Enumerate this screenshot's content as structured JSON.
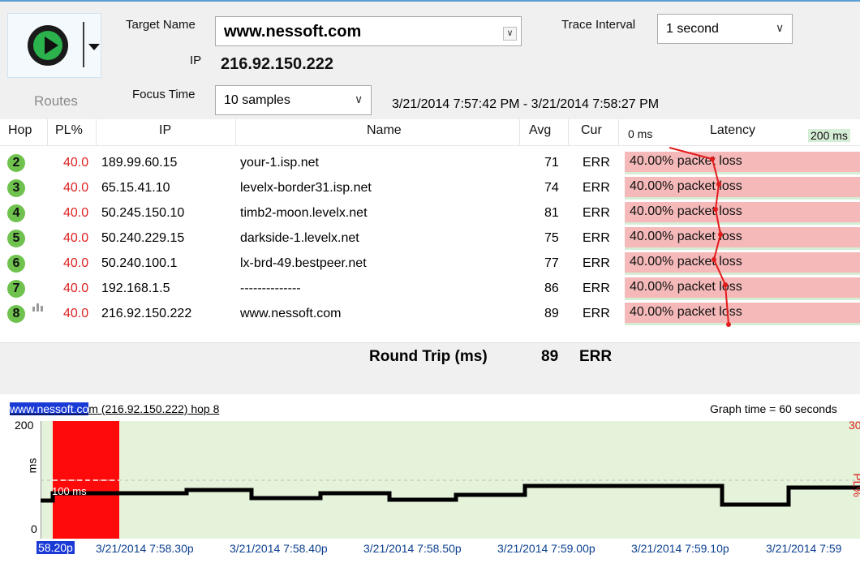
{
  "toolbar": {
    "routes_label": "Routes"
  },
  "target": {
    "name_label": "Target Name",
    "name_value": "www.nessoft.com",
    "ip_label": "IP",
    "ip_value": "216.92.150.222",
    "trace_interval_label": "Trace Interval",
    "trace_interval_value": "1 second",
    "focus_time_label": "Focus Time",
    "focus_time_value": "10 samples",
    "time_range": "3/21/2014 7:57:42 PM - 3/21/2014 7:58:27 PM"
  },
  "table": {
    "headers": {
      "hop": "Hop",
      "pl": "PL%",
      "ip": "IP",
      "name": "Name",
      "avg": "Avg",
      "cur": "Cur",
      "lat_min": "0 ms",
      "lat_title": "Latency",
      "lat_max": "200 ms"
    },
    "rows": [
      {
        "hop": "2",
        "pl": "40.0",
        "ip": "189.99.60.15",
        "name": "your-1.isp.net",
        "avg": "71",
        "cur": "ERR",
        "latency": "40.00% packet loss"
      },
      {
        "hop": "3",
        "pl": "40.0",
        "ip": "65.15.41.10",
        "name": "levelx-border31.isp.net",
        "avg": "74",
        "cur": "ERR",
        "latency": "40.00% packet loss"
      },
      {
        "hop": "4",
        "pl": "40.0",
        "ip": "50.245.150.10",
        "name": "timb2-moon.levelx.net",
        "avg": "81",
        "cur": "ERR",
        "latency": "40.00% packet loss"
      },
      {
        "hop": "5",
        "pl": "40.0",
        "ip": "50.240.229.15",
        "name": "darkside-1.levelx.net",
        "avg": "75",
        "cur": "ERR",
        "latency": "40.00% packet loss"
      },
      {
        "hop": "6",
        "pl": "40.0",
        "ip": "50.240.100.1",
        "name": "lx-brd-49.bestpeer.net",
        "avg": "77",
        "cur": "ERR",
        "latency": "40.00% packet loss"
      },
      {
        "hop": "7",
        "pl": "40.0",
        "ip": "192.168.1.5",
        "name": "--------------",
        "avg": "86",
        "cur": "ERR",
        "latency": "40.00% packet loss"
      },
      {
        "hop": "8",
        "pl": "40.0",
        "ip": "216.92.150.222",
        "name": "www.nessoft.com",
        "avg": "89",
        "cur": "ERR",
        "latency": "40.00% packet loss"
      }
    ],
    "round_trip_label": "Round Trip (ms)",
    "round_trip_avg": "89",
    "round_trip_cur": "ERR"
  },
  "graph": {
    "title_highlight": "www.nessoft.co",
    "title_rest": "m (216.92.150.222) hop 8",
    "graph_time": "Graph time = 60 seconds",
    "y_max": "200",
    "y_mid": "100 ms",
    "y_zero": "0",
    "y_axis": "ms",
    "pl_axis": "PL%",
    "pl_max": "30",
    "x_labels": [
      "58.20p",
      "3/21/2014 7:58.30p",
      "3/21/2014 7:58.40p",
      "3/21/2014 7:58.50p",
      "3/21/2014 7:59.00p",
      "3/21/2014 7:59.10p",
      "3/21/2014 7:59"
    ]
  },
  "colors": {
    "packet_loss_bg": "#f5b9b9",
    "graph_bg": "#e4f3da",
    "loss_bar": "#ff0a0a",
    "hop_badge": "#6fc24e",
    "pl_text": "#dd2222"
  }
}
